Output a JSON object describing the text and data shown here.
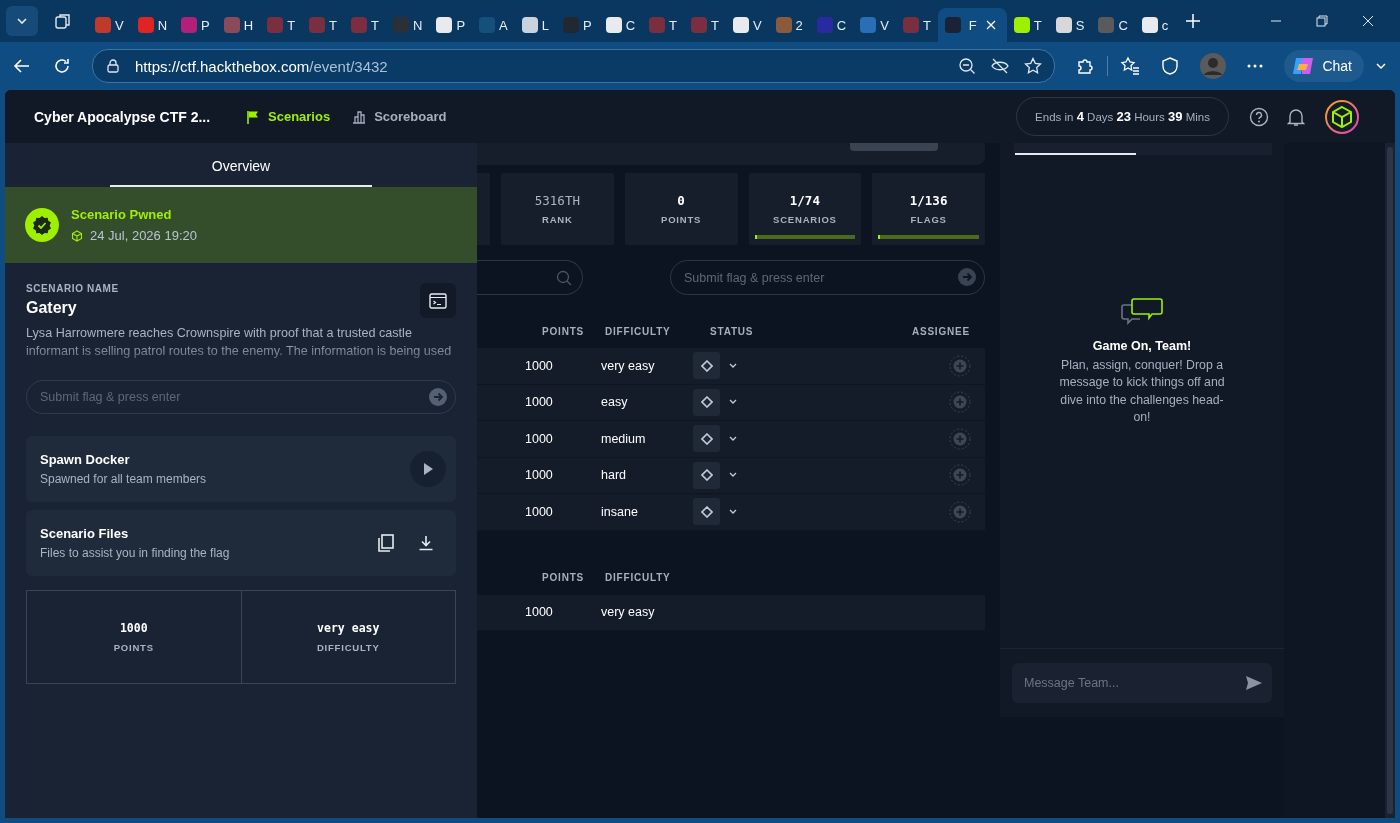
{
  "browser": {
    "tabs": [
      {
        "label": "V",
        "color": "#c0392b",
        "selected": false
      },
      {
        "label": "N",
        "color": "#e02424",
        "selected": false
      },
      {
        "label": "P",
        "color": "#b3207a",
        "selected": false
      },
      {
        "label": "H",
        "color": "#8a4a5a",
        "selected": false
      },
      {
        "label": "T",
        "color": "#7a2e3e",
        "selected": false
      },
      {
        "label": "T",
        "color": "#7a2e3e",
        "selected": false
      },
      {
        "label": "T",
        "color": "#7a2e3e",
        "selected": false
      },
      {
        "label": "N",
        "color": "#2b2f36",
        "selected": false
      },
      {
        "label": "P",
        "color": "#e8eaed",
        "selected": false
      },
      {
        "label": "A",
        "color": "#16507a",
        "selected": false
      },
      {
        "label": "L",
        "color": "#c8d3dd",
        "selected": false
      },
      {
        "label": "P",
        "color": "#222831",
        "selected": false
      },
      {
        "label": "C",
        "color": "#e8eaed",
        "selected": false
      },
      {
        "label": "T",
        "color": "#7a2e3e",
        "selected": false
      },
      {
        "label": "T",
        "color": "#7a2e3e",
        "selected": false
      },
      {
        "label": "V",
        "color": "#e8eaed",
        "selected": false
      },
      {
        "label": "2",
        "color": "#8a5a3a",
        "selected": false
      },
      {
        "label": "C",
        "color": "#2a2aa0",
        "selected": false
      },
      {
        "label": "V",
        "color": "#2a6fb5",
        "selected": false
      },
      {
        "label": "T",
        "color": "#7a2e3e",
        "selected": false
      },
      {
        "label": "F",
        "color": "#1a2333",
        "selected": true
      },
      {
        "label": "T",
        "color": "#9fef00",
        "selected": false
      },
      {
        "label": "S",
        "color": "#d8d8d8",
        "selected": false
      },
      {
        "label": "C",
        "color": "#5a5a5a",
        "selected": false
      },
      {
        "label": "c",
        "color": "#e8eaed",
        "selected": false
      }
    ],
    "url_host": "https://ctf.hackthebox.com",
    "url_path": "/event/3432",
    "chat_button": "Chat"
  },
  "header": {
    "title": "Cyber Apocalypse CTF 2...",
    "nav": [
      {
        "label": "Scenarios",
        "selected": true
      },
      {
        "label": "Scoreboard",
        "selected": false
      }
    ],
    "timer": "Ends in **4** Days **23** Hours **39** Mins"
  },
  "drawer": {
    "tab": "Overview",
    "status": {
      "title": "Scenario Pwned",
      "date": "24 Jul, 2026 19:20"
    },
    "name_label": "SCENARIO NAME",
    "name": "Gatery",
    "description": "Lysa Harrowmere reaches Crownspire with proof that a trusted castle informant is selling patrol routes to the enemy. The information is being used",
    "flag": {
      "placeholder": "Submit flag & press enter"
    },
    "actions": [
      {
        "kind": "docker",
        "title": "Spawn Docker",
        "subtitle": "Spawned for all team members"
      },
      {
        "kind": "files",
        "title": "Scenario Files",
        "subtitle": "Files to assist you in finding the flag"
      }
    ],
    "stats": [
      {
        "value": "1000",
        "label": "POINTS"
      },
      {
        "value": "very easy",
        "label": "DIFFICULTY"
      }
    ]
  },
  "stats": [
    {
      "kind": "plain",
      "value": "5316TH",
      "label": "RANK"
    },
    {
      "kind": "plain",
      "value": "0",
      "label": "POINTS"
    },
    {
      "kind": "progress",
      "value": "1/74",
      "label": "SCENARIOS",
      "level": 0.014
    },
    {
      "kind": "progress",
      "value": "1/136",
      "label": "FLAGS",
      "level": 0.008
    }
  ],
  "flag_field": {
    "placeholder": "Submit flag & press enter"
  },
  "table": {
    "columns": [
      "POINTS",
      "DIFFICULTY",
      "STATUS",
      "ASSIGNEE"
    ],
    "rows": [
      {
        "points": "1000",
        "difficulty": "very easy"
      },
      {
        "points": "1000",
        "difficulty": "easy"
      },
      {
        "points": "1000",
        "difficulty": "medium"
      },
      {
        "points": "1000",
        "difficulty": "hard"
      },
      {
        "points": "1000",
        "difficulty": "insane"
      }
    ]
  },
  "table_2": {
    "columns": [
      "POINTS",
      "DIFFICULTY"
    ],
    "rows": [
      {
        "points": "1000",
        "difficulty": "very easy"
      }
    ]
  },
  "chat": {
    "title": "Game On, Team!",
    "message": "Plan, assign, conquer! Drop a message to kick things off and dive into the challenges head-on!",
    "placeholder": "Message Team..."
  }
}
